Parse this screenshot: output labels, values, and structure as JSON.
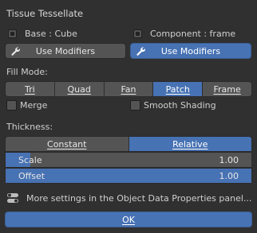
{
  "dialog": {
    "title": "Tissue Tessellate",
    "base": {
      "label": "Base : Cube",
      "modifiers_button": "Use Modifiers",
      "modifiers_active": false
    },
    "component": {
      "label": "Component : frame",
      "modifiers_button": "Use Modifiers",
      "modifiers_active": true
    },
    "fill_mode": {
      "label": "Fill Mode:",
      "options": [
        {
          "label": "Tri",
          "active": false
        },
        {
          "label": "Quad",
          "active": false
        },
        {
          "label": "Fan",
          "active": false
        },
        {
          "label": "Patch",
          "active": true
        },
        {
          "label": "Frame",
          "active": false
        }
      ]
    },
    "merge": {
      "label": "Merge",
      "checked": false
    },
    "smooth_shading": {
      "label": "Smooth Shading",
      "checked": false
    },
    "thickness": {
      "label": "Thickness:",
      "modes": [
        {
          "label": "Constant",
          "active": false
        },
        {
          "label": "Relative",
          "active": true
        }
      ],
      "scale": {
        "label": "Scale",
        "value": "1.00",
        "fill_fraction": 0.1
      },
      "offset": {
        "label": "Offset",
        "value": "1.00",
        "fill_fraction": 1.0
      }
    },
    "info_text": "More settings in the Object Data Properties panel...",
    "ok_button": "OK"
  },
  "colors": {
    "accent": "#4772b3",
    "background": "#303030",
    "widget": "#545454"
  }
}
